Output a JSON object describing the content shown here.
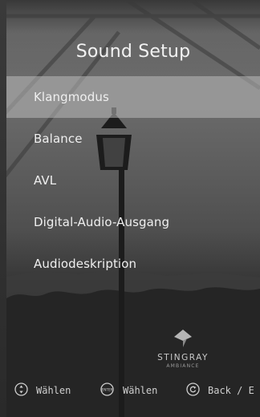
{
  "screen": {
    "title": "Sound Setup"
  },
  "menu": {
    "items": [
      {
        "label": "Klangmodus",
        "selected": true
      },
      {
        "label": "Balance",
        "selected": false
      },
      {
        "label": "AVL",
        "selected": false
      },
      {
        "label": "Digital-Audio-Ausgang",
        "selected": false
      },
      {
        "label": "Audiodeskription",
        "selected": false
      }
    ]
  },
  "brand": {
    "name": "STINGRAY",
    "subtitle": "AMBIANCE"
  },
  "footer": {
    "hints": [
      {
        "icon": "up-down-arrows-icon",
        "label": "Wählen"
      },
      {
        "icon": "enter-button-icon",
        "icon_text": "ENTER",
        "label": "Wählen"
      },
      {
        "icon": "back-icon",
        "label": "Back / E"
      }
    ]
  }
}
